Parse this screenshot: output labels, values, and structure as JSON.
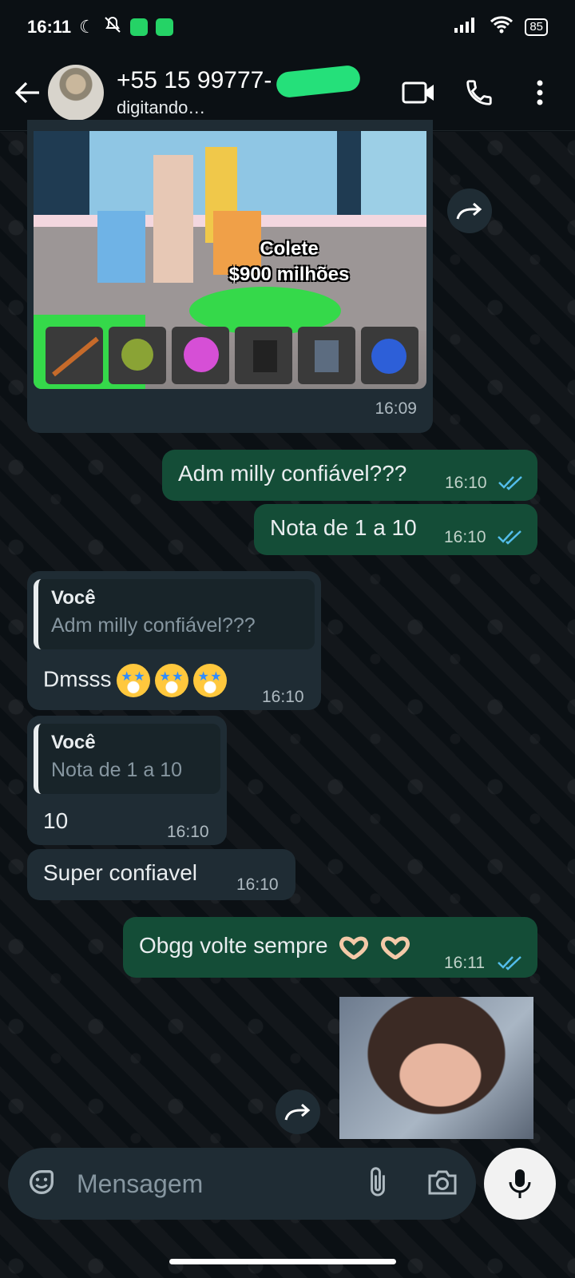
{
  "status_bar": {
    "time": "16:11",
    "battery": "85"
  },
  "header": {
    "contact_name": "+55 15 99777-",
    "status": "digitando…"
  },
  "game_image": {
    "caption_line1": "Colete",
    "caption_line2": "$900 milhões",
    "time": "16:09"
  },
  "messages": [
    {
      "text": "Adm milly confiável???",
      "time": "16:10"
    },
    {
      "text": "Nota de 1 a 10",
      "time": "16:10"
    },
    {
      "quote_author": "Você",
      "quote_text": "Adm milly confiável???",
      "text": "Dmsss",
      "time": "16:10"
    },
    {
      "quote_author": "Você",
      "quote_text": "Nota de 1 a 10",
      "text": "10",
      "time": "16:10"
    },
    {
      "text": "Super confiavel",
      "time": "16:10"
    },
    {
      "text": "Obgg volte sempre",
      "time": "16:11"
    }
  ],
  "input": {
    "placeholder": "Mensagem"
  },
  "colors": {
    "outgoing": "#144d37",
    "incoming": "#1f2c34",
    "read_ticks": "#53bdeb"
  }
}
